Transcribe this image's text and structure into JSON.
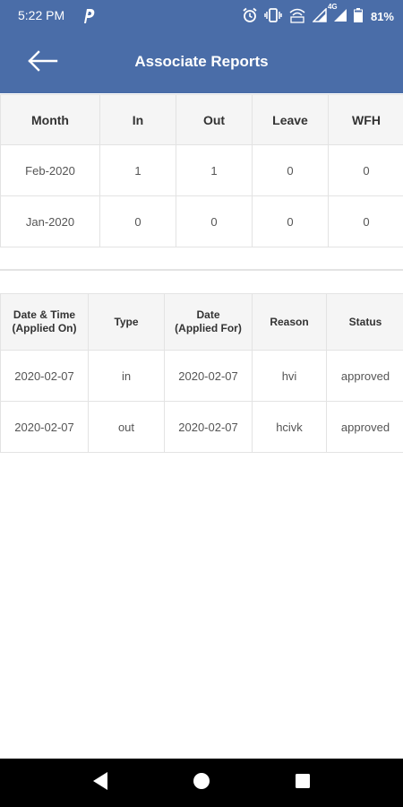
{
  "status_bar": {
    "time": "5:22 PM",
    "battery_percent": "81%",
    "network_label": "4G"
  },
  "header": {
    "title": "Associate Reports",
    "background_color": "#4a6da8"
  },
  "summary_table": {
    "columns": [
      "Month",
      "In",
      "Out",
      "Leave",
      "WFH"
    ],
    "rows": [
      [
        "Feb-2020",
        "1",
        "1",
        "0",
        "0"
      ],
      [
        "Jan-2020",
        "0",
        "0",
        "0",
        "0"
      ]
    ]
  },
  "requests_table": {
    "columns": [
      [
        "Date & Time",
        "(Applied On)"
      ],
      [
        "Type"
      ],
      [
        "Date",
        "(Applied For)"
      ],
      [
        "Reason"
      ],
      [
        "Status"
      ]
    ],
    "rows": [
      [
        "2020-02-07",
        "in",
        "2020-02-07",
        "hvi",
        "approved"
      ],
      [
        "2020-02-07",
        "out",
        "2020-02-07",
        "hcivk",
        "approved"
      ]
    ]
  },
  "icons": {
    "back": "back-arrow-icon",
    "nav_back": "triangle-back-icon",
    "nav_home": "circle-home-icon",
    "nav_recents": "square-recents-icon"
  }
}
